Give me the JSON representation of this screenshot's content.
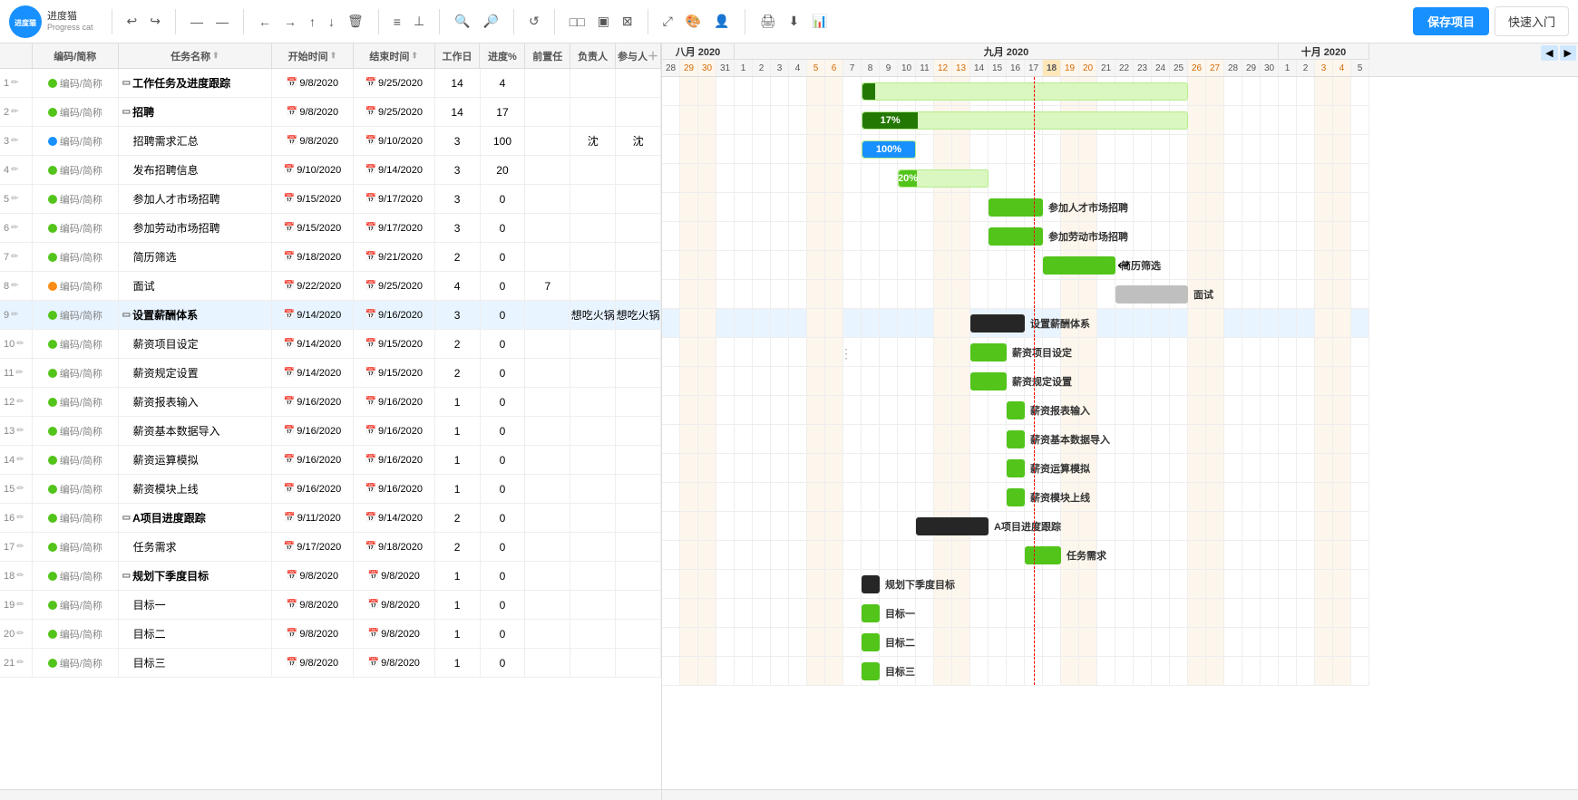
{
  "app": {
    "logo_text": "进度猫",
    "logo_subtext": "Progress cat",
    "save_btn": "保存项目",
    "quickstart_btn": "快速入门"
  },
  "toolbar": {
    "buttons": [
      "↩",
      "↪",
      "——",
      "——",
      "←→",
      "↑",
      "↓",
      "🗑",
      "≡≡",
      "⊥",
      "🔍+",
      "🔍-",
      "↺",
      "□□□",
      "▣",
      "⊠",
      "🎨",
      "👤",
      "🖨",
      "⬇",
      "📊"
    ]
  },
  "table": {
    "headers": [
      "编码/简称",
      "任务名称",
      "开始时间",
      "结束时间",
      "工作日",
      "进度%",
      "前置任",
      "负责人",
      "参与人"
    ],
    "rows": [
      {
        "num": "1",
        "edit": true,
        "dot": "green",
        "code": "编码/简称",
        "expand": true,
        "name": "工作任务及进度跟踪",
        "start": "9/8/2020",
        "end": "9/25/2020",
        "workday": "14",
        "progress": "4",
        "prereq": "",
        "owner": "",
        "member": ""
      },
      {
        "num": "2",
        "edit": true,
        "dot": "green",
        "code": "编码/简称",
        "expand": true,
        "name": "招聘",
        "start": "9/8/2020",
        "end": "9/25/2020",
        "workday": "14",
        "progress": "17",
        "prereq": "",
        "owner": "",
        "member": ""
      },
      {
        "num": "3",
        "edit": true,
        "dot": "blue",
        "code": "编码/简称",
        "expand": false,
        "name": "招聘需求汇总",
        "start": "9/8/2020",
        "end": "9/10/2020",
        "workday": "3",
        "progress": "100",
        "prereq": "",
        "owner": "沈",
        "member": "沈",
        "child": true
      },
      {
        "num": "4",
        "edit": true,
        "dot": "green",
        "code": "编码/简称",
        "expand": false,
        "name": "发布招聘信息",
        "start": "9/10/2020",
        "end": "9/14/2020",
        "workday": "3",
        "progress": "20",
        "prereq": "",
        "owner": "",
        "member": "",
        "child": true
      },
      {
        "num": "5",
        "edit": true,
        "dot": "green",
        "code": "编码/简称",
        "expand": false,
        "name": "参加人才市场招聘",
        "start": "9/15/2020",
        "end": "9/17/2020",
        "workday": "3",
        "progress": "0",
        "prereq": "",
        "owner": "",
        "member": "",
        "child": true
      },
      {
        "num": "6",
        "edit": true,
        "dot": "green",
        "code": "编码/简称",
        "expand": false,
        "name": "参加劳动市场招聘",
        "start": "9/15/2020",
        "end": "9/17/2020",
        "workday": "3",
        "progress": "0",
        "prereq": "",
        "owner": "",
        "member": "",
        "child": true
      },
      {
        "num": "7",
        "edit": true,
        "dot": "green",
        "code": "编码/简称",
        "expand": false,
        "name": "简历筛选",
        "start": "9/18/2020",
        "end": "9/21/2020",
        "workday": "2",
        "progress": "0",
        "prereq": "",
        "owner": "",
        "member": "",
        "child": true
      },
      {
        "num": "8",
        "edit": true,
        "dot": "orange",
        "code": "编码/简称",
        "expand": false,
        "name": "面试",
        "start": "9/22/2020",
        "end": "9/25/2020",
        "workday": "4",
        "progress": "0",
        "prereq": "7",
        "owner": "",
        "member": "",
        "child": true
      },
      {
        "num": "9",
        "edit": true,
        "dot": "green",
        "code": "编码/简称",
        "expand": true,
        "name": "设置薪酬体系",
        "start": "9/14/2020",
        "end": "9/16/2020",
        "workday": "3",
        "progress": "0",
        "prereq": "",
        "owner": "想吃火锅",
        "member": "想吃火锅",
        "highlight": true
      },
      {
        "num": "10",
        "edit": true,
        "dot": "green",
        "code": "编码/简称",
        "expand": false,
        "name": "薪资项目设定",
        "start": "9/14/2020",
        "end": "9/15/2020",
        "workday": "2",
        "progress": "0",
        "prereq": "",
        "owner": "",
        "member": "",
        "child": true
      },
      {
        "num": "11",
        "edit": true,
        "dot": "green",
        "code": "编码/简称",
        "expand": false,
        "name": "薪资规定设置",
        "start": "9/14/2020",
        "end": "9/15/2020",
        "workday": "2",
        "progress": "0",
        "prereq": "",
        "owner": "",
        "member": "",
        "child": true
      },
      {
        "num": "12",
        "edit": true,
        "dot": "green",
        "code": "编码/简称",
        "expand": false,
        "name": "薪资报表输入",
        "start": "9/16/2020",
        "end": "9/16/2020",
        "workday": "1",
        "progress": "0",
        "prereq": "",
        "owner": "",
        "member": "",
        "child": true
      },
      {
        "num": "13",
        "edit": true,
        "dot": "green",
        "code": "编码/简称",
        "expand": false,
        "name": "薪资基本数据导入",
        "start": "9/16/2020",
        "end": "9/16/2020",
        "workday": "1",
        "progress": "0",
        "prereq": "",
        "owner": "",
        "member": "",
        "child": true
      },
      {
        "num": "14",
        "edit": true,
        "dot": "green",
        "code": "编码/简称",
        "expand": false,
        "name": "薪资运算模拟",
        "start": "9/16/2020",
        "end": "9/16/2020",
        "workday": "1",
        "progress": "0",
        "prereq": "",
        "owner": "",
        "member": "",
        "child": true
      },
      {
        "num": "15",
        "edit": true,
        "dot": "green",
        "code": "编码/简称",
        "expand": false,
        "name": "薪资模块上线",
        "start": "9/16/2020",
        "end": "9/16/2020",
        "workday": "1",
        "progress": "0",
        "prereq": "",
        "owner": "",
        "member": "",
        "child": true
      },
      {
        "num": "16",
        "edit": true,
        "dot": "green",
        "code": "编码/简称",
        "expand": true,
        "name": "A项目进度跟踪",
        "start": "9/11/2020",
        "end": "9/14/2020",
        "workday": "2",
        "progress": "0",
        "prereq": "",
        "owner": "",
        "member": ""
      },
      {
        "num": "17",
        "edit": true,
        "dot": "green",
        "code": "编码/简称",
        "expand": false,
        "name": "任务需求",
        "start": "9/17/2020",
        "end": "9/18/2020",
        "workday": "2",
        "progress": "0",
        "prereq": "",
        "owner": "",
        "member": "",
        "child": true
      },
      {
        "num": "18",
        "edit": true,
        "dot": "green",
        "code": "编码/简称",
        "expand": true,
        "name": "规划下季度目标",
        "start": "9/8/2020",
        "end": "9/8/2020",
        "workday": "1",
        "progress": "0",
        "prereq": "",
        "owner": "",
        "member": ""
      },
      {
        "num": "19",
        "edit": true,
        "dot": "green",
        "code": "编码/简称",
        "expand": false,
        "name": "目标一",
        "start": "9/8/2020",
        "end": "9/8/2020",
        "workday": "1",
        "progress": "0",
        "prereq": "",
        "owner": "",
        "member": "",
        "child": true
      },
      {
        "num": "20",
        "edit": true,
        "dot": "green",
        "code": "编码/简称",
        "expand": false,
        "name": "目标二",
        "start": "9/8/2020",
        "end": "9/8/2020",
        "workday": "1",
        "progress": "0",
        "prereq": "",
        "owner": "",
        "member": "",
        "child": true
      },
      {
        "num": "21",
        "edit": true,
        "dot": "green",
        "code": "编码/简称",
        "expand": false,
        "name": "目标三",
        "start": "9/8/2020",
        "end": "9/8/2020",
        "workday": "1",
        "progress": "0",
        "prereq": "",
        "owner": "",
        "member": "",
        "child": true
      }
    ]
  },
  "gantt": {
    "month": "九月 2020",
    "days_aug": [
      "28",
      "29",
      "30",
      "31"
    ],
    "days_sep": [
      "1",
      "2",
      "3",
      "4",
      "5",
      "6",
      "7",
      "8",
      "9",
      "10",
      "11",
      "12",
      "13",
      "14",
      "15",
      "16",
      "17",
      "18",
      "19",
      "20",
      "21",
      "22",
      "23",
      "24",
      "25",
      "26",
      "27",
      "28",
      "29",
      "30"
    ],
    "days_oct": [
      "1",
      "2",
      "3",
      "4",
      "5"
    ],
    "bars": [
      {
        "row": 0,
        "label": "工作任务及进度跟踪",
        "startDay": 8,
        "endDay": 25,
        "progress": 4,
        "type": "green",
        "dark": true
      },
      {
        "row": 1,
        "label": "招聘",
        "startDay": 8,
        "endDay": 25,
        "progress": 17,
        "type": "green",
        "dark": true
      },
      {
        "row": 2,
        "label": "招聘需求汇总",
        "startDay": 8,
        "endDay": 10,
        "progress": 100,
        "type": "blue"
      },
      {
        "row": 3,
        "label": "发布招聘信息",
        "startDay": 10,
        "endDay": 14,
        "progress": 20,
        "type": "green"
      },
      {
        "row": 4,
        "label": "参加人才市场招聘",
        "startDay": 15,
        "endDay": 17,
        "progress": 0,
        "type": "green"
      },
      {
        "row": 5,
        "label": "参加劳动市场招聘",
        "startDay": 15,
        "endDay": 17,
        "progress": 0,
        "type": "green"
      },
      {
        "row": 6,
        "label": "简历筛选",
        "startDay": 18,
        "endDay": 21,
        "progress": 0,
        "type": "green"
      },
      {
        "row": 7,
        "label": "面试",
        "startDay": 22,
        "endDay": 25,
        "progress": 0,
        "type": "gray"
      },
      {
        "row": 8,
        "label": "设置薪酬体系",
        "startDay": 14,
        "endDay": 16,
        "progress": 0,
        "type": "black"
      },
      {
        "row": 9,
        "label": "薪资项目设定",
        "startDay": 14,
        "endDay": 15,
        "progress": 0,
        "type": "green"
      },
      {
        "row": 10,
        "label": "薪资规定设置",
        "startDay": 14,
        "endDay": 15,
        "progress": 0,
        "type": "green"
      },
      {
        "row": 11,
        "label": "薪资报表输入",
        "startDay": 16,
        "endDay": 16,
        "progress": 0,
        "type": "green"
      },
      {
        "row": 12,
        "label": "薪资基本数据导入",
        "startDay": 16,
        "endDay": 16,
        "progress": 0,
        "type": "green"
      },
      {
        "row": 13,
        "label": "薪资运算模拟",
        "startDay": 16,
        "endDay": 16,
        "progress": 0,
        "type": "green"
      },
      {
        "row": 14,
        "label": "薪资模块上线",
        "startDay": 16,
        "endDay": 16,
        "progress": 0,
        "type": "green"
      },
      {
        "row": 15,
        "label": "A项目进度跟踪",
        "startDay": 11,
        "endDay": 14,
        "progress": 0,
        "type": "black"
      },
      {
        "row": 16,
        "label": "任务需求",
        "startDay": 17,
        "endDay": 18,
        "progress": 0,
        "type": "green"
      },
      {
        "row": 17,
        "label": "规划下季度目标",
        "startDay": 8,
        "endDay": 8,
        "progress": 0,
        "type": "black"
      },
      {
        "row": 18,
        "label": "目标一",
        "startDay": 8,
        "endDay": 8,
        "progress": 0,
        "type": "green"
      },
      {
        "row": 19,
        "label": "目标二",
        "startDay": 8,
        "endDay": 8,
        "progress": 0,
        "type": "green"
      },
      {
        "row": 20,
        "label": "目标三",
        "startDay": 8,
        "endDay": 8,
        "progress": 0,
        "type": "green"
      }
    ]
  }
}
